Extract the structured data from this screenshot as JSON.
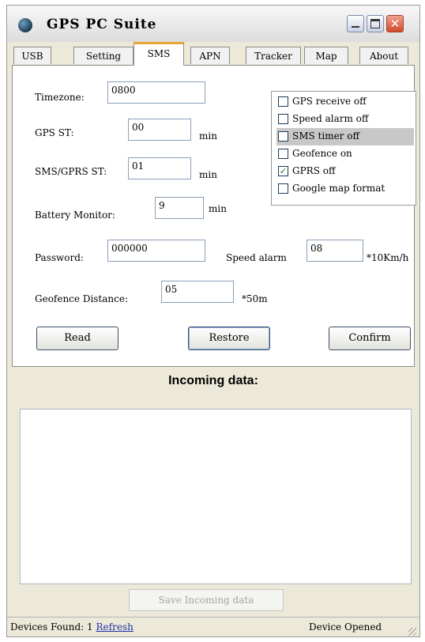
{
  "window": {
    "title": "GPS PC Suite"
  },
  "tabs": [
    {
      "label": "USB"
    },
    {
      "label": "Setting"
    },
    {
      "label": "SMS",
      "active": true
    },
    {
      "label": "APN"
    },
    {
      "label": "Tracker"
    },
    {
      "label": "Map"
    },
    {
      "label": "About"
    }
  ],
  "form": {
    "timezone": {
      "label": "Timezone:",
      "value": "0800"
    },
    "gps_st": {
      "label": "GPS ST:",
      "value": "00",
      "unit": "min"
    },
    "sms_gprs_st": {
      "label": "SMS/GPRS ST:",
      "value": "01",
      "unit": "min"
    },
    "battery_monitor": {
      "label": "Battery Monitor:",
      "value": "9",
      "unit": "min"
    },
    "password": {
      "label": "Password:",
      "value": "000000"
    },
    "speed_alarm": {
      "label": "Speed alarm",
      "value": "08",
      "unit": "*10Km/h"
    },
    "geofence_distance": {
      "label": "Geofence Distance:",
      "value": "05",
      "unit": "*50m"
    }
  },
  "options": [
    {
      "label": "GPS receive off",
      "checked": false
    },
    {
      "label": "Speed alarm off",
      "checked": false
    },
    {
      "label": "SMS timer off",
      "checked": false,
      "highlighted": true
    },
    {
      "label": "Geofence on",
      "checked": false
    },
    {
      "label": "GPRS off",
      "checked": true
    },
    {
      "label": "Google map format",
      "checked": false
    }
  ],
  "buttons": {
    "read": "Read",
    "restore": "Restore",
    "confirm": "Confirm"
  },
  "incoming": {
    "title": "Incoming data:",
    "content": "",
    "save_label": "Save Incoming data"
  },
  "status": {
    "devices_found_label": "Devices Found:",
    "devices_found_count": "1",
    "refresh_label": "Refresh",
    "device_state": "Device Opened"
  },
  "colors": {
    "active_tab_accent": "#e8a838",
    "close_button": "#d24a2c",
    "link": "#1e2ea8"
  }
}
